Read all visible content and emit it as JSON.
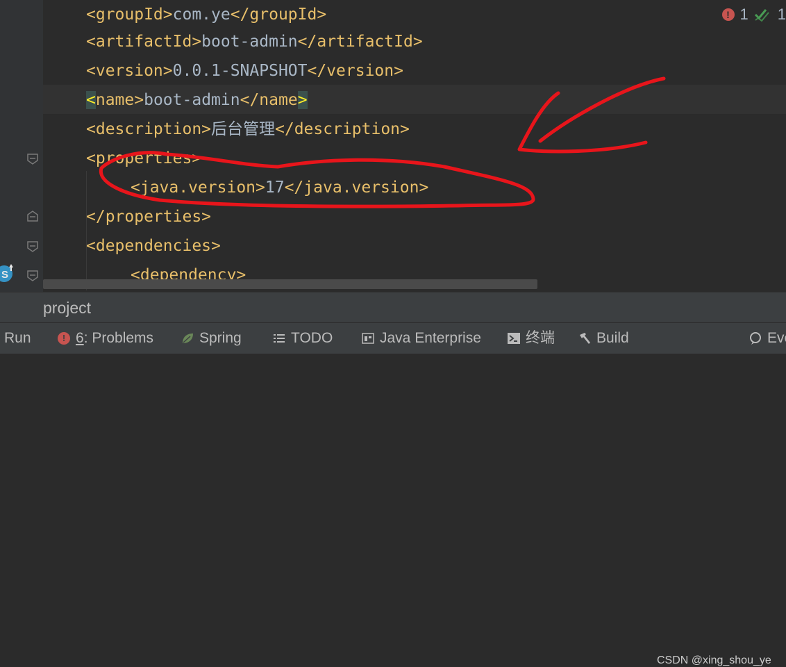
{
  "editor": {
    "lines": [
      {
        "open": "<groupId>",
        "value": "com.ye",
        "close": "</groupId>"
      },
      {
        "open": "<artifactId>",
        "value": "boot-admin",
        "close": "</artifactId>"
      },
      {
        "open": "<version>",
        "value": "0.0.1-SNAPSHOT",
        "close": "</version>"
      },
      {
        "open_lt": "<",
        "open_rest": "name>",
        "value": "boot-admin",
        "close_main": "</name",
        "close_gt": ">"
      },
      {
        "open": "<description>",
        "value": "后台管理",
        "close": "</description>"
      },
      {
        "open": "<properties>"
      },
      {
        "open": "<java.version>",
        "value": "17",
        "close": "</java.version>"
      },
      {
        "open": "</properties>"
      },
      {
        "open": "<dependencies>"
      },
      {
        "open": "<dependency>"
      }
    ],
    "inspections": {
      "errors": "1",
      "ok": "1"
    }
  },
  "panel": {
    "title": "project"
  },
  "toolbar": {
    "run": "Run",
    "problems_key": "6",
    "problems_rest": ": Problems",
    "spring": "Spring",
    "todo": "TODO",
    "java_enterprise": "Java Enterprise",
    "terminal": "终端",
    "build": "Build",
    "event_log": "Eve"
  },
  "watermark": "CSDN @xing_shou_ye",
  "colors": {
    "tag": "#e8bf6a",
    "text": "#a9b7c6",
    "match_highlight": "#ffef28",
    "annotation": "#e8151b",
    "error": "#c75450",
    "ok": "#499c54"
  }
}
